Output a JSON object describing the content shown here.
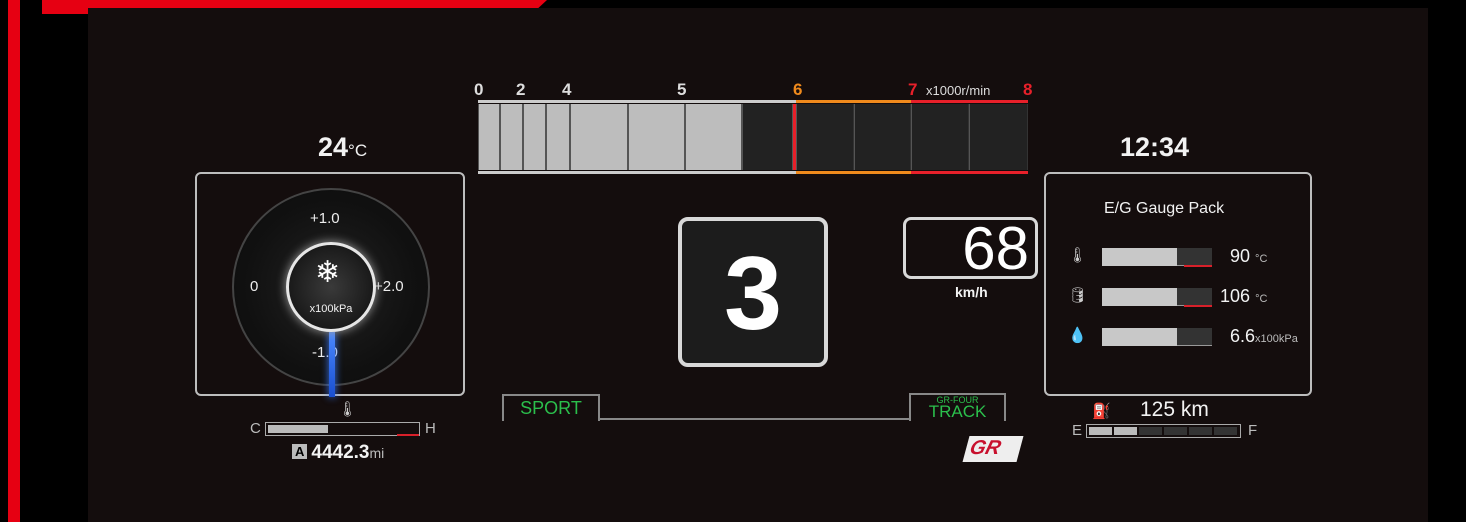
{
  "tach": {
    "labels": [
      "0",
      "2",
      "4",
      "5",
      "6",
      "7",
      "8"
    ],
    "unit": "x1000r/min",
    "current_rpm_fraction": 0.57
  },
  "left": {
    "ambient_temp_value": "24",
    "ambient_temp_unit": "°C",
    "boost_gauge": {
      "label_top": "+1.0",
      "label_left": "0",
      "label_right": "+2.0",
      "label_bottom": "-1.0",
      "unit": "x100kPa"
    },
    "coolant_c": "C",
    "coolant_h": "H",
    "coolant_level": 0.4,
    "odometer_prefix": "A",
    "odometer_value": "4442.3",
    "odometer_unit": "mi"
  },
  "center": {
    "gear": "3",
    "speed": "68",
    "speed_unit": "km/h",
    "drive_mode": "SPORT",
    "awd_mode_small": "GR-FOUR",
    "awd_mode": "TRACK",
    "logo_text": "GR"
  },
  "right": {
    "clock": "12:34",
    "gauge_pack_title": "E/G Gauge Pack",
    "gauges": [
      {
        "icon": "coolant-temp-icon",
        "value": "90",
        "unit": "°C",
        "level": 0.68
      },
      {
        "icon": "oil-temp-icon",
        "value": "106",
        "unit": "°C",
        "level": 0.68
      },
      {
        "icon": "oil-pressure-icon",
        "value": "6.6",
        "unit": "x100kPa",
        "level": 0.68
      }
    ],
    "range_value": "125 km",
    "fuel_e": "E",
    "fuel_f": "F",
    "fuel_level": 0.35
  },
  "colors": {
    "frame_red": "#e60012",
    "mode_green": "#2bbf4c",
    "redline": "#e8202a",
    "warn_orange": "#f08a1c"
  }
}
